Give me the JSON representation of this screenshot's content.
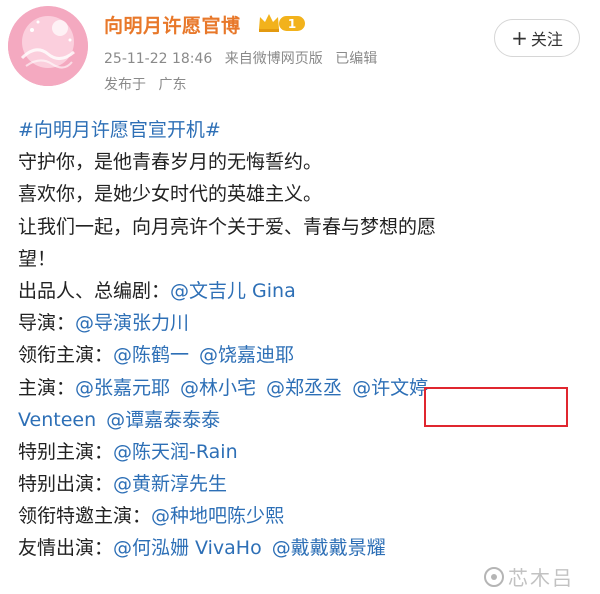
{
  "header": {
    "account_name": "向明月许愿官博",
    "vip_level": "1",
    "date_time": "25-11-22 18:46",
    "source": "来自微博网页版",
    "edited": "已编辑",
    "location_label": "发布于",
    "location": "广东",
    "follow_label": "关注"
  },
  "post": {
    "hashtag": "#向明月许愿官宣开机#",
    "line1": "守护你，是他青春岁月的无悔誓约。",
    "line2": "喜欢你，是她少女时代的英雄主义。",
    "line3": "让我们一起，向月亮许个关于爱、青春与梦想的愿",
    "line4": "望！",
    "credits": {
      "producer_label": "出品人、总编剧：",
      "producer": "@文吉儿 Gina",
      "director_label": "导演：",
      "director": "@导演张力川",
      "leads_label": "领衔主演：",
      "leads": [
        "@陈鹤一",
        "@饶嘉迪耶"
      ],
      "cast_label": "主演：",
      "cast": [
        "@张嘉元耶",
        "@林小宅",
        "@郑丞丞",
        "@许文婷",
        "Venteen",
        "@谭嘉泰泰泰"
      ],
      "special_star_label": "特别主演：",
      "special_star": "@陈天润-Rain",
      "special_appearance_label": "特别出演：",
      "special_appearance": "@黄新淳先生",
      "special_guest_label": "领衔特邀主演：",
      "special_guest": "@种地吧陈少熙",
      "friendly_label": "友情出演：",
      "friendly": [
        "@何泓姗 VivaHo",
        "@戴戴戴景耀"
      ]
    }
  },
  "watermark": {
    "text": "芯木吕"
  },
  "colors": {
    "account_name": "#e8782a",
    "link": "#2d6fb6",
    "meta": "#8a8a8a",
    "highlight": "#e0262f",
    "vip": "#f2b21c"
  }
}
